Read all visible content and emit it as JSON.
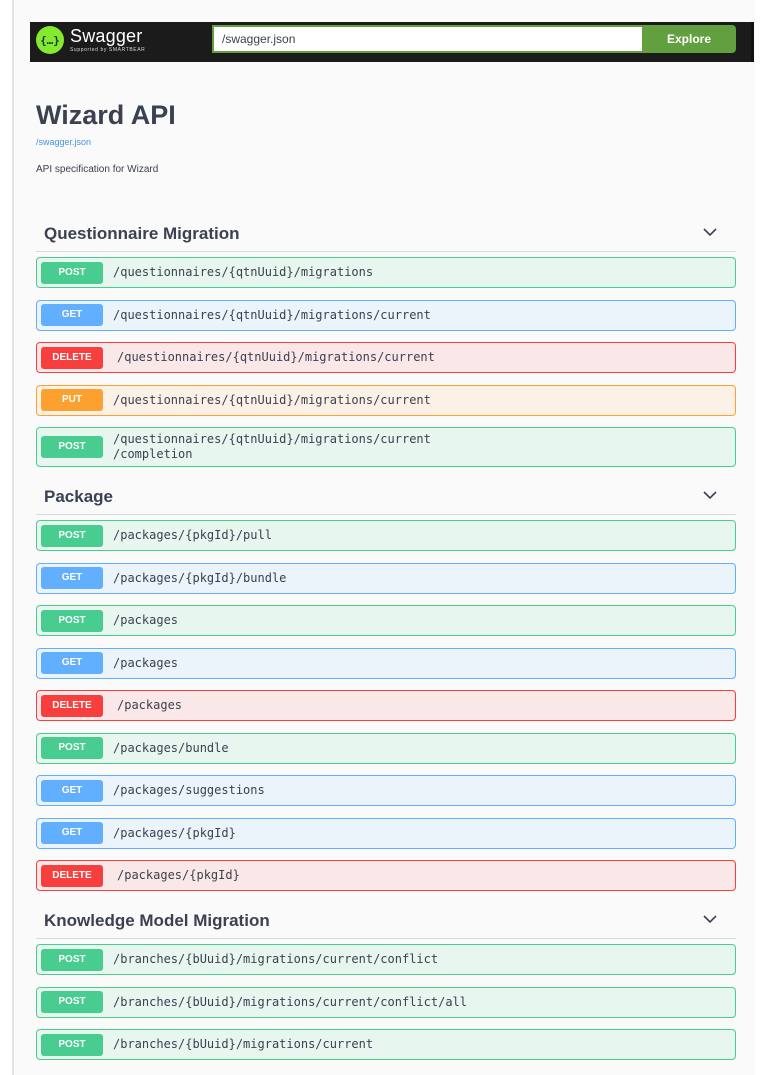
{
  "topbar": {
    "logo_name": "Swagger",
    "logo_sub": "Supported by SMARTBEAR",
    "url_value": "/swagger.json",
    "explore_label": "Explore"
  },
  "info": {
    "title": "Wizard API",
    "spec_link": "/swagger.json",
    "description": "API specification for Wizard"
  },
  "sections": [
    {
      "name": "Questionnaire Migration",
      "operations": [
        {
          "method": "POST",
          "path": "/questionnaires/{qtnUuid}/migrations"
        },
        {
          "method": "GET",
          "path": "/questionnaires/{qtnUuid}/migrations/current"
        },
        {
          "method": "DELETE",
          "path": "/questionnaires/{qtnUuid}/migrations/current"
        },
        {
          "method": "PUT",
          "path": "/questionnaires/{qtnUuid}/migrations/current"
        },
        {
          "method": "POST",
          "path": "/questionnaires/{qtnUuid}/migrations/current\n/completion"
        }
      ]
    },
    {
      "name": "Package",
      "operations": [
        {
          "method": "POST",
          "path": "/packages/{pkgId}/pull"
        },
        {
          "method": "GET",
          "path": "/packages/{pkgId}/bundle"
        },
        {
          "method": "POST",
          "path": "/packages"
        },
        {
          "method": "GET",
          "path": "/packages"
        },
        {
          "method": "DELETE",
          "path": "/packages"
        },
        {
          "method": "POST",
          "path": "/packages/bundle"
        },
        {
          "method": "GET",
          "path": "/packages/suggestions"
        },
        {
          "method": "GET",
          "path": "/packages/{pkgId}"
        },
        {
          "method": "DELETE",
          "path": "/packages/{pkgId}"
        }
      ]
    },
    {
      "name": "Knowledge Model Migration",
      "operations": [
        {
          "method": "POST",
          "path": "/branches/{bUuid}/migrations/current/conflict"
        },
        {
          "method": "POST",
          "path": "/branches/{bUuid}/migrations/current/conflict/all"
        },
        {
          "method": "POST",
          "path": "/branches/{bUuid}/migrations/current"
        }
      ]
    }
  ],
  "colors": {
    "post": "#49cc90",
    "get": "#61affe",
    "delete": "#f93e3e",
    "put": "#fca130",
    "explore": "#62a03f"
  },
  "icons": {
    "logo": "swagger-logo-icon",
    "section_toggle": "chevron-down-icon"
  }
}
